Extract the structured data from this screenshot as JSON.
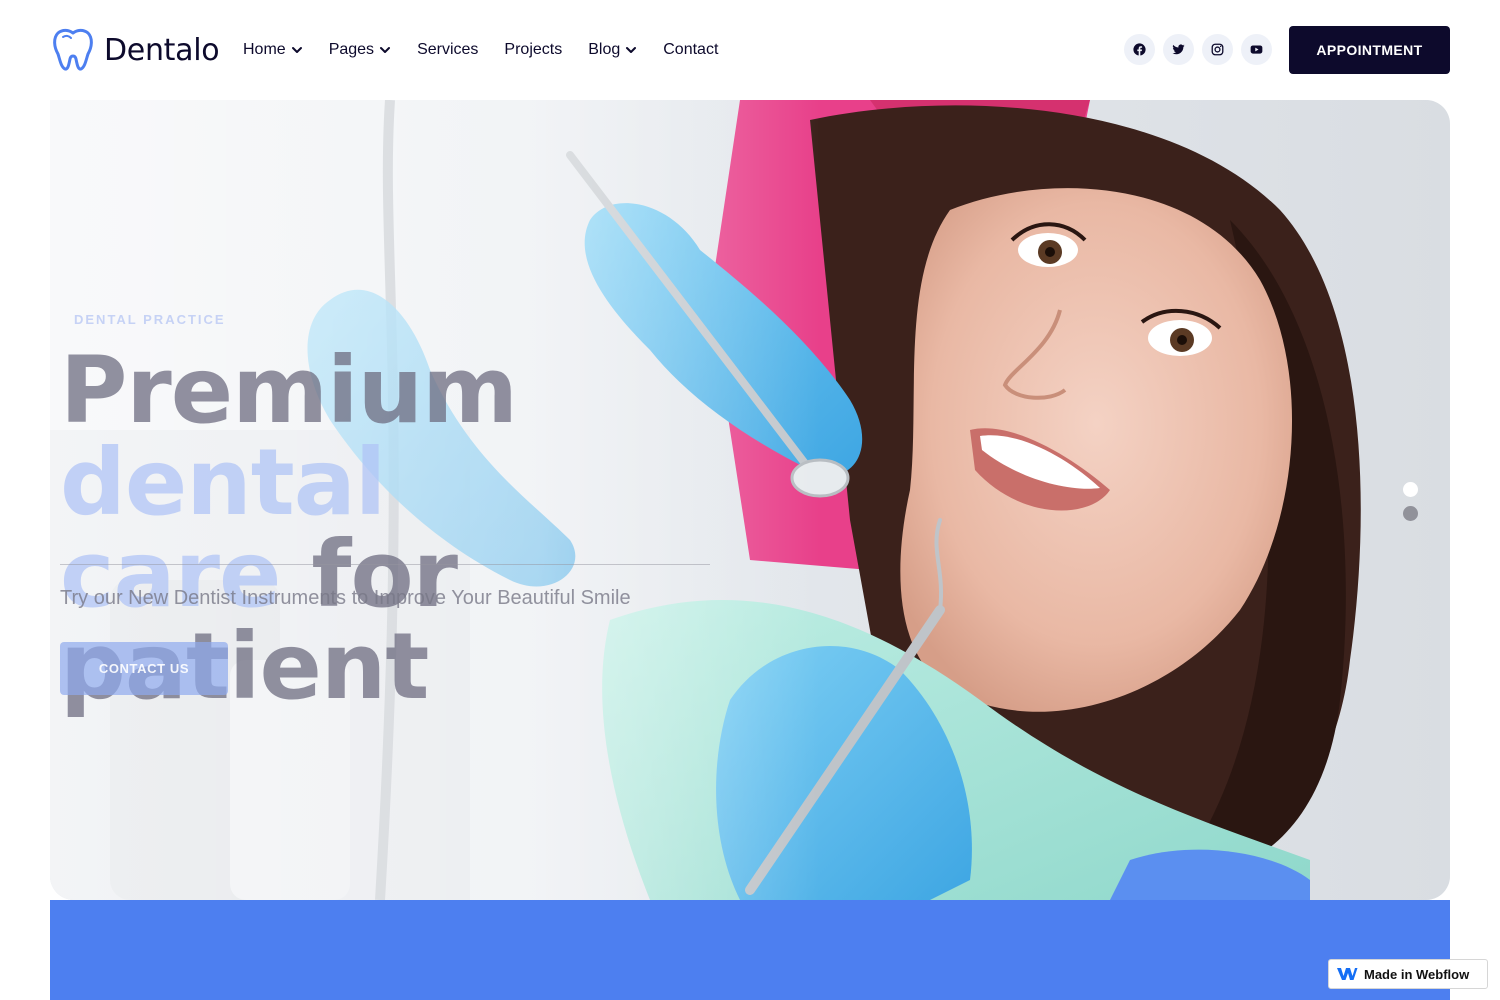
{
  "brand": {
    "name": "Dentalo"
  },
  "nav": {
    "items": [
      {
        "label": "Home",
        "has_dropdown": true
      },
      {
        "label": "Pages",
        "has_dropdown": true
      },
      {
        "label": "Services",
        "has_dropdown": false
      },
      {
        "label": "Projects",
        "has_dropdown": false
      },
      {
        "label": "Blog",
        "has_dropdown": true
      },
      {
        "label": "Contact",
        "has_dropdown": false
      }
    ]
  },
  "socials": [
    "facebook-icon",
    "twitter-icon",
    "instagram-icon",
    "youtube-icon"
  ],
  "appointment_button": {
    "label": "APPOINTMENT"
  },
  "hero": {
    "eyebrow": "DENTAL PRACTICE",
    "headline_part1": "Premium ",
    "headline_accent1": "dental",
    "headline_accent2": "care",
    "headline_part2": " for patient",
    "subtitle": "Try our New Dentist Instruments to Improve Your Beautiful Smile",
    "cta_label": "CONTACT US",
    "slides_total": 2,
    "active_slide": 1
  },
  "badge": {
    "label": "Made in Webflow"
  },
  "colors": {
    "brand_dark": "#0d0a2c",
    "accent_blue": "#4d7ff0",
    "social_bg": "#eef1f8"
  }
}
